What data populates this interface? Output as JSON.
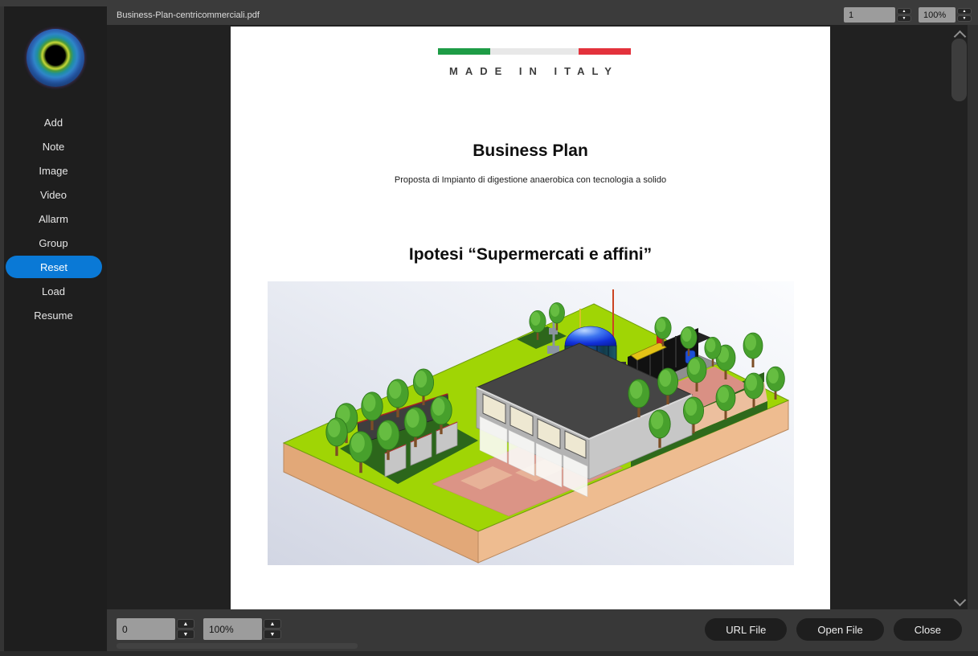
{
  "titlebar": {
    "document_tab": "Business-Plan-centricommerciali.pdf",
    "page_number": "1",
    "zoom_level": "100%"
  },
  "sidebar": {
    "items": [
      {
        "label": "Add"
      },
      {
        "label": "Note"
      },
      {
        "label": "Image"
      },
      {
        "label": "Video"
      },
      {
        "label": "Allarm"
      },
      {
        "label": "Group"
      },
      {
        "label": "Reset"
      },
      {
        "label": "Load"
      },
      {
        "label": "Resume"
      }
    ],
    "active_item": "Reset"
  },
  "pdf_page": {
    "made_in_italy": "MADE IN ITALY",
    "title": "Business Plan",
    "subtitle": "Proposta di Impianto di digestione anaerobica con tecnologia a solido",
    "section_heading": "Ipotesi “Supermercati e affini”",
    "figure_description": "3D isometric rendering of an anaerobic digestion biogas plant: landscaped green lot on a tan earth base with rows of trees, a grey industrial building with glass bays, a blue domed digester tank, a black cogeneration container and salmon-coloured paved paths."
  },
  "bottom_bar": {
    "page_spinner": "0",
    "zoom_spinner": "100%",
    "buttons": [
      {
        "label": "URL File"
      },
      {
        "label": "Open File"
      },
      {
        "label": "Close"
      }
    ]
  },
  "icons": {
    "spin_up": "▲",
    "spin_down": "▼"
  },
  "colors": {
    "accent_blue": "#0a79d6",
    "flag_green": "#1e9c46",
    "flag_grey": "#e8e8e8",
    "flag_red": "#e3323c",
    "topbar": "#3b3b3b",
    "sidebar_bg": "#1e1e1e",
    "viewer_bg": "#212121",
    "bottombar_bg": "#383838",
    "field_grey": "#9c9c9c",
    "grass_green": "#a0d505",
    "earth_tan": "#e9b184",
    "path_salmon": "#db9486",
    "dome_blue": "#1130d8"
  }
}
